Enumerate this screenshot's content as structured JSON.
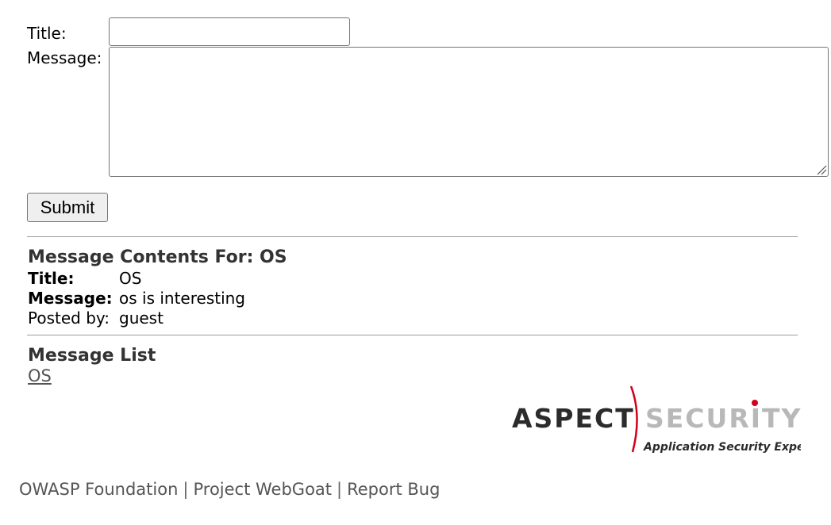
{
  "form": {
    "title_label": "Title:",
    "title_value": "",
    "message_label": "Message:",
    "message_value": "",
    "submit_label": "Submit"
  },
  "message_contents": {
    "heading": "Message Contents For: OS",
    "title_label": "Title:",
    "title_value": "OS",
    "message_label": "Message:",
    "message_value": "os is interesting",
    "posted_by_label": "Posted by:",
    "posted_by_value": "guest"
  },
  "message_list": {
    "heading": "Message List",
    "items": [
      {
        "label": "OS"
      }
    ]
  },
  "logo": {
    "word1": "ASPECT",
    "word2": "SECURITY",
    "tagline": "Application Security Experts",
    "accent_color": "#d0021b"
  },
  "footer": {
    "links": [
      {
        "label": "OWASP Foundation"
      },
      {
        "label": "Project WebGoat"
      },
      {
        "label": "Report Bug"
      }
    ],
    "separator": "|"
  }
}
